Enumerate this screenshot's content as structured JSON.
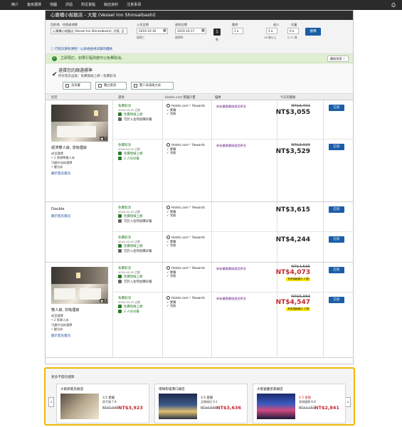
{
  "nav": {
    "items": [
      "簡介",
      "客房選擇",
      "地圖",
      "評語",
      "附近景點",
      "飯店資料",
      "注意事項"
    ],
    "print_icon": "printer-icon"
  },
  "hotel": {
    "title": "心齋橋小船飯店 - 大阪 (Vessel Inn Shinsaibashi)"
  },
  "search": {
    "destination_label": "目的地、住宿或地標",
    "destination_value": "心齋橋小船飯店 (Vessel Inn Shinsaibashi), 大阪, 日",
    "checkin_label": "入住日期",
    "checkin_value": "2019-10-16",
    "checkin_day": "星期三",
    "checkout_label": "退房日期",
    "checkout_value": "2019-10-17",
    "checkout_day": "星期四",
    "nights_value": "1",
    "nights_unit": "晚",
    "rooms_label": "客房",
    "rooms_value": "1",
    "adults_label": "成人",
    "adults_value": "2",
    "adults_sub": "18 歲以上",
    "children_label": "兒童",
    "children_value": "0",
    "children_sub": "0-17 歲",
    "search_button": "搜尋",
    "flex_link": "行程日期有彈性？以表格檢視日期的價格"
  },
  "banner": {
    "text": "立即預訂，如果行程改變可以免費取消。",
    "guarantee": "價格保證"
  },
  "filters": {
    "title": "選擇您的篩選標準",
    "subtitle": "所有客房設施：免費無線上網・免費取消",
    "buttons": [
      "含早餐",
      "獨立衛浴",
      "雙人床或兩大床"
    ]
  },
  "table": {
    "headers": [
      "房型",
      "選項",
      "Hotels.com 獎勵計畫",
      "優惠",
      "今天的價格"
    ]
  },
  "rooms": [
    {
      "name": "經濟雙人房, 非吸煙房",
      "photo_count": "5",
      "details": [
        "床型選擇",
        "• 1 張標準雙人床",
        "可額外加床選擇",
        "• 嬰兒床"
      ],
      "link": "顯示客房資訊",
      "options": [
        {
          "cancel": "免費取消",
          "date": "2019-10-15 之前",
          "features": [
            "免費無線上網",
            "可於入住時加購早餐"
          ],
          "rewards": [
            "Hotels.com™ Rewards",
            "累積",
            "兌換"
          ],
          "member": "神秘優惠價格適用更多",
          "old_price": "NT$3,401",
          "price": "NT$3,055",
          "book": "訂房"
        },
        {
          "cancel": "免費取消",
          "date": "2019-10-15 之前",
          "features": [
            "免費無線上網",
            "2 人份早餐"
          ],
          "rewards": [
            "Hotels.com™ Rewards",
            "累積",
            "兌換"
          ],
          "member": "神秘優惠價格適用更多",
          "old_price": "NT$3,929",
          "price": "NT$3,529",
          "book": "訂房"
        }
      ]
    },
    {
      "name": "Double",
      "link": "顯示客房資訊",
      "options": [
        {
          "cancel": "免費取消",
          "date": "2019-10-15 之前",
          "features": [
            "免費無線上網",
            "可於入住時加購早餐"
          ],
          "rewards": [
            "Hotels.com™ Rewards",
            "累積",
            "兌換"
          ],
          "price": "NT$3,615",
          "book": "訂房"
        },
        {
          "cancel": "免費取消",
          "date": "2019-10-15 之前",
          "features": [
            "免費無線上網",
            "可於入住時加購早餐"
          ],
          "rewards": [
            "Hotels.com™ Rewards",
            "累積",
            "兌換"
          ],
          "price": "NT$4,244",
          "book": "訂房"
        }
      ]
    },
    {
      "name": "雙人房, 非吸煙房",
      "photo_count": "6",
      "details": [
        "床型選擇",
        "• 2 張單人床",
        "可額外加床選擇",
        "• 嬰兒床"
      ],
      "link": "顯示客房資訊",
      "options": [
        {
          "cancel": "免費取消",
          "date": "2019-10-15 之前",
          "features": [
            "免費無線上網",
            "可於入住時加購早餐"
          ],
          "rewards": [
            "Hotels.com™ Rewards",
            "累積",
            "兌換"
          ],
          "member": "神秘優惠價格適用更多",
          "old_price": "NT$4,535",
          "price": "NT$4,073",
          "badge": "會員價格顯示 3 間",
          "book": "訂房"
        },
        {
          "cancel": "免費取消",
          "date": "2019-10-15 之前",
          "features": [
            "免費無線上網",
            "2 人份早餐"
          ],
          "rewards": [
            "Hotels.com™ Rewards",
            "累積",
            "兌換"
          ],
          "member": "神秘優惠價格適用更多",
          "old_price": "NT$5,063",
          "price": "NT$4,547",
          "badge": "會員價格顯示 3 間",
          "book": "訂房"
        }
      ]
    }
  ],
  "more": {
    "title": "更多不錯的選擇",
    "prev": "‹",
    "next": "›",
    "cards": [
      {
        "name": "大阪新阪急飯店",
        "stars": "3.5 星級",
        "rating": "很不錯 7.8",
        "old_price": "NT$5,046",
        "price": "NT$3,923"
      },
      {
        "name": "環球影城港口飯店",
        "stars": "3.5 星級",
        "rating": "品質絕佳 9.2",
        "old_price": "NT$4,644",
        "price": "NT$3,636"
      },
      {
        "name": "大阪富麗皇家飯店",
        "stars": "4.5 星級",
        "rating": "表現優異 8.8",
        "old_price": "NT$3,162",
        "price": "NT$2,841"
      }
    ]
  }
}
